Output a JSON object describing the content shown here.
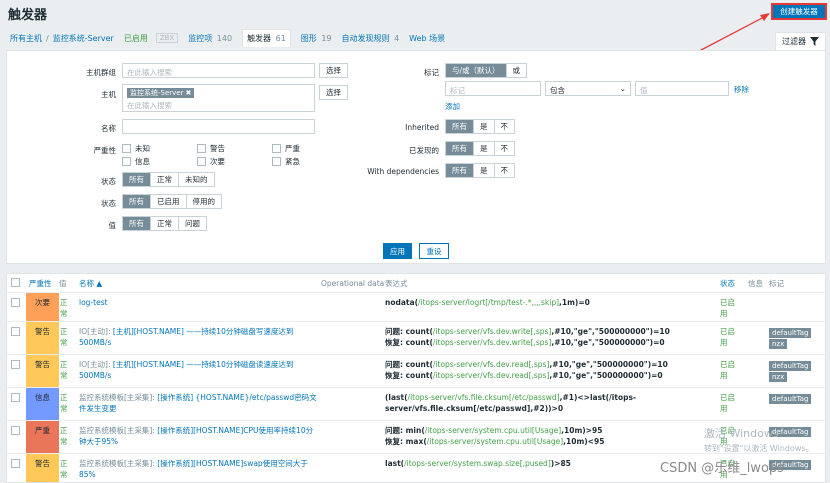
{
  "header": {
    "title": "触发器",
    "create_label": "创建触发器"
  },
  "breadcrumb": {
    "all_hosts": "所有主机",
    "host": "监控系统-Server",
    "status": "已启用",
    "zbx": "ZBX",
    "items": [
      {
        "label": "监控项",
        "count": "140"
      },
      {
        "label": "触发器",
        "count": "61"
      },
      {
        "label": "图形",
        "count": "19"
      },
      {
        "label": "自动发现规则",
        "count": "4"
      },
      {
        "label": "Web 场景",
        "count": ""
      }
    ]
  },
  "filter": {
    "tab_label": "过滤器",
    "host_group_label": "主机群组",
    "host_group_placeholder": "在此输入搜索",
    "select": "选择",
    "host_label": "主机",
    "host_tag": "监控系统-Server",
    "host_placeholder": "在此输入搜索",
    "name_label": "名称",
    "severity_label": "严重性",
    "severities": [
      "未知",
      "警告",
      "严重",
      "信息",
      "次要",
      "紧急"
    ],
    "state_label": "状态",
    "state_options": [
      "所有",
      "正常",
      "未知的"
    ],
    "status_label": "状态",
    "status_options": [
      "所有",
      "已启用",
      "停用的"
    ],
    "value_label": "值",
    "value_options": [
      "所有",
      "正常",
      "问题"
    ],
    "tags_label": "标记",
    "tags_mode": [
      "与/或（默认）",
      "或"
    ],
    "tag_placeholder": "标记",
    "tag_op": "包含",
    "tag_value_placeholder": "值",
    "remove": "移除",
    "add": "添加",
    "inherited_label": "Inherited",
    "discovered_label": "已发现的",
    "deps_label": "With dependencies",
    "tri_options": [
      "所有",
      "是",
      "不"
    ],
    "apply": "应用",
    "reset": "重设"
  },
  "table": {
    "headers": {
      "severity": "严重性",
      "value": "值",
      "name": "名称 ▲",
      "opdata": "Operational data",
      "expr": "表达式",
      "status": "状态",
      "info": "信息",
      "tags": "标记"
    },
    "rows": [
      {
        "severity": "次要",
        "sevcolor": "#ffa059",
        "value": "正常",
        "name_prefix": "",
        "name": "log-test",
        "expr": [
          [
            "nodata(",
            "/itops-server/logrt[/tmp/test-.*,,,,skip]",
            ",1m)=0"
          ]
        ],
        "status": "已启用",
        "tags": []
      },
      {
        "severity": "警告",
        "sevcolor": "#ffc859",
        "value": "正常",
        "name_prefix": "IO[主动]: ",
        "name": "[主机][HOST.NAME] ——持续10分钟磁盘写速度达到500MB/s",
        "expr": [
          [
            "问题: count(",
            "/itops-server/vfs.dev.write[,sps]",
            ",#10,\"ge\",\"500000000\")=10"
          ],
          [
            "恢复: count(",
            "/itops-server/vfs.dev.write[,sps]",
            ",#10,\"ge\",\"500000000\")=0"
          ]
        ],
        "status": "已启用",
        "tags": [
          "defaultTag",
          "nzx"
        ]
      },
      {
        "severity": "警告",
        "sevcolor": "#ffc859",
        "value": "正常",
        "name_prefix": "IO[主动]: ",
        "name": "[主机][HOST.NAME] ——持续10分钟磁盘读速度达到500MB/s",
        "expr": [
          [
            "问题: count(",
            "/itops-server/vfs.dev.read[,sps]",
            ",#10,\"ge\",\"500000000\")=10"
          ],
          [
            "恢复: count(",
            "/itops-server/vfs.dev.read[,sps]",
            ",#10,\"ge\",\"500000000\")=0"
          ]
        ],
        "status": "已启用",
        "tags": [
          "defaultTag",
          "nzx"
        ]
      },
      {
        "severity": "信息",
        "sevcolor": "#7499ff",
        "value": "正常",
        "name_prefix": "监控系统模板[主采集]: ",
        "name": "[操作系统] {HOST.NAME}/etc/passwd密码文件发生变更",
        "expr": [
          [
            "(last(",
            "/itops-server/vfs.file.cksum[/etc/passwd]",
            ",#1)<>last(/itops-server/vfs.file.cksum[/etc/passwd],#2))>0"
          ]
        ],
        "status": "已启用",
        "tags": [
          "defaultTag"
        ]
      },
      {
        "severity": "严重",
        "sevcolor": "#e97659",
        "value": "正常",
        "name_prefix": "监控系统模板[主采集]: ",
        "name": "[操作系统][HOST.NAME]CPU使用率持续10分钟大于95%",
        "expr": [
          [
            "问题: min(",
            "/itops-server/system.cpu.util[Usage]",
            ",10m)>95"
          ],
          [
            "恢复: max(",
            "/itops-server/system.cpu.util[Usage]",
            ",10m)<95"
          ]
        ],
        "status": "已启用",
        "tags": [
          "defaultTag"
        ]
      },
      {
        "severity": "警告",
        "sevcolor": "#ffc859",
        "value": "正常",
        "name_prefix": "监控系统模板[主采集]: ",
        "name": "[操作系统][HOST.NAME]swap使用空间大于85%",
        "expr": [
          [
            "last(",
            "/itops-server/system.swap.size[,pused]",
            ")>85"
          ]
        ],
        "status": "已启用",
        "tags": [
          "defaultTag"
        ]
      }
    ]
  },
  "watermark": {
    "line1": "激活 Windows",
    "line2": "转到\"设置\"以激活 Windows。",
    "csdn": "CSDN @乐维_lwops"
  }
}
